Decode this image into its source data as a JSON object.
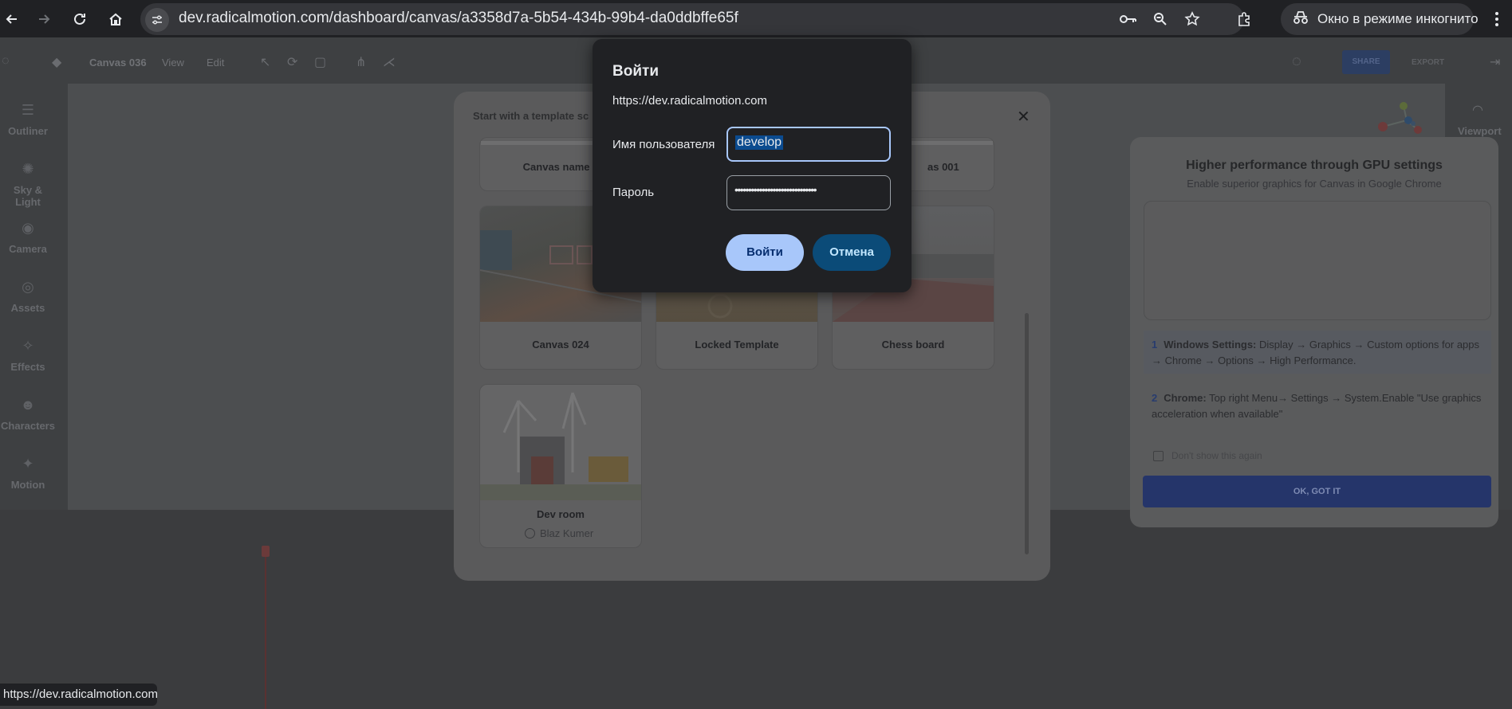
{
  "browser": {
    "url": "dev.radicalmotion.com/dashboard/canvas/a3358d7a-5b54-434b-99b4-da0ddbffe65f",
    "incognito_label": "Окно в режиме инкогнито",
    "status_url": "https://dev.radicalmotion.com"
  },
  "toolbar": {
    "canvas_name": "Canvas 036",
    "menu_view": "View",
    "menu_edit": "Edit",
    "share_label": "SHARE",
    "export_label": "EXPORT"
  },
  "sidebar": {
    "items": [
      {
        "label": "Outliner",
        "icon": "layers-icon"
      },
      {
        "label": "Sky & Light",
        "icon": "sun-icon"
      },
      {
        "label": "Camera",
        "icon": "camera-icon"
      },
      {
        "label": "Assets",
        "icon": "assets-icon"
      },
      {
        "label": "Effects",
        "icon": "effects-icon"
      },
      {
        "label": "Characters",
        "icon": "character-icon"
      },
      {
        "label": "Motion",
        "icon": "motion-icon"
      }
    ]
  },
  "rightbar": {
    "viewport_label": "Viewport"
  },
  "template_modal": {
    "title": "Start with a template sc",
    "cards_top": [
      {
        "label": "Canvas name 0"
      },
      {
        "label": "as 001"
      }
    ],
    "cards": [
      {
        "label": "Canvas 024"
      },
      {
        "label": "Locked Template"
      },
      {
        "label": "Chess board"
      },
      {
        "label": "Dev room",
        "author": "Blaz Kumer"
      }
    ]
  },
  "gpu_panel": {
    "title": "Higher performance through GPU settings",
    "subtitle": "Enable superior graphics for Canvas in Google Chrome",
    "step1_num": "1",
    "step1_head": "Windows Settings:",
    "step1_text": "Display → Graphics → Custom options for apps → Chrome → Options → High Performance.",
    "step2_num": "2",
    "step2_head": "Chrome:",
    "step2_text": "Top right Menu→ Settings → System.Enable \"Use graphics acceleration when available\"",
    "dont_show": "Don't show this again",
    "ok_label": "OK, GOT IT"
  },
  "login": {
    "title": "Войти",
    "site": "https://dev.radicalmotion.com",
    "username_label": "Имя пользователя",
    "username_value": "develop",
    "password_label": "Пароль",
    "password_mask": "••••••••••••••••••••••••••••••",
    "signin_label": "Войти",
    "cancel_label": "Отмена"
  },
  "colors": {
    "accent": "#a8c7fa",
    "cancel_bg": "#0b4b78",
    "dialog_bg": "#202124"
  }
}
